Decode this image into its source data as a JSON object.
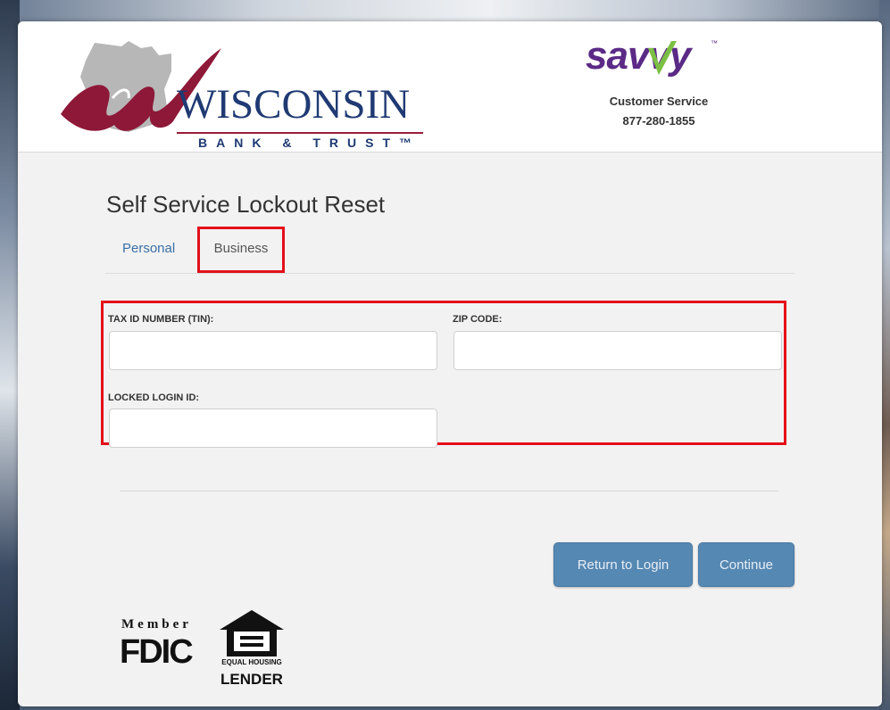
{
  "header": {
    "bank_name": "WISCONSIN",
    "bank_subtitle": "BANK & TRUST™",
    "savvy_logo": "savvy",
    "savvy_tm": "™",
    "customer_service_label": "Customer Service",
    "customer_service_phone": "877-280-1855"
  },
  "page": {
    "title": "Self Service Lockout Reset"
  },
  "tabs": [
    {
      "label": "Personal",
      "selected": false
    },
    {
      "label": "Business",
      "selected": true
    }
  ],
  "form": {
    "tin_label": "TAX ID NUMBER (TIN):",
    "tin_value": "",
    "zip_label": "ZIP CODE:",
    "zip_value": "",
    "login_label": "LOCKED LOGIN ID:",
    "login_value": ""
  },
  "buttons": {
    "return_label": "Return to Login",
    "continue_label": "Continue"
  },
  "footer": {
    "fdic_member": "Member",
    "fdic_word": "FDIC",
    "ehl_subtitle": "EQUAL HOUSING",
    "ehl_lender": "LENDER"
  },
  "colors": {
    "highlight_red": "#e3101a",
    "button_blue": "#5588b3",
    "brand_navy": "#1f3a73",
    "brand_maroon": "#9b1b3a",
    "savvy_purple": "#5b2a86",
    "savvy_green": "#7bc043"
  }
}
